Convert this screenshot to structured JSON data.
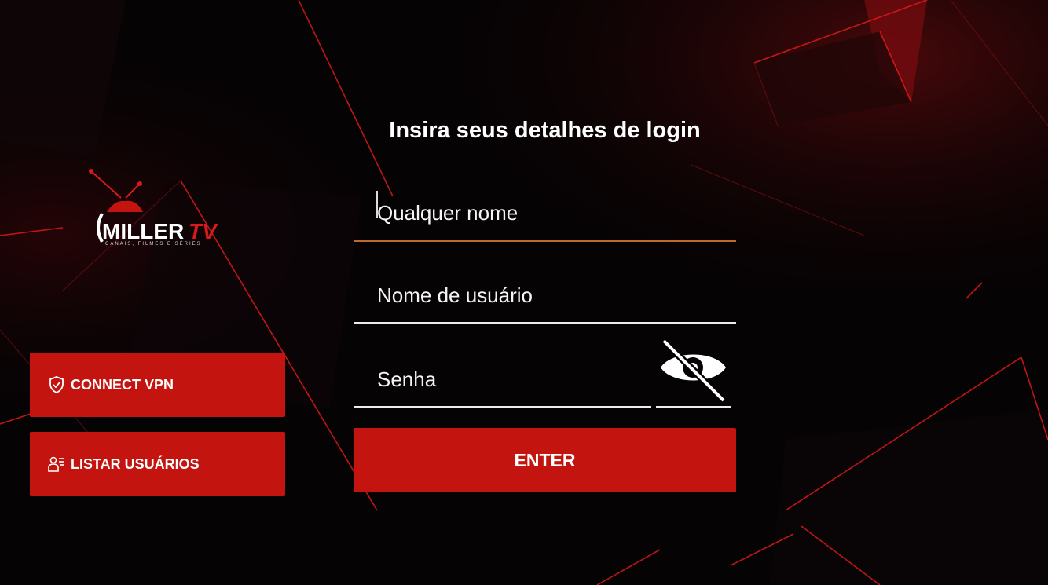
{
  "login": {
    "title": "Insira seus detalhes de login",
    "name_placeholder": "Qualquer nome",
    "username_placeholder": "Nome de usuário",
    "password_placeholder": "Senha",
    "enter_label": "ENTER"
  },
  "sidebar": {
    "logo_text": "MILLERTV",
    "logo_tagline": "CANAIS, FILMES E SÉRIES",
    "buttons": [
      {
        "label": "CONNECT VPN",
        "icon": "shield-check-icon"
      },
      {
        "label": "LISTAR USUÁRIOS",
        "icon": "user-list-icon"
      }
    ]
  },
  "colors": {
    "accent": "#c4140f",
    "background": "#050203",
    "active_underline": "#c06a2a"
  },
  "icons": {
    "password_toggle": "eye-slash-icon"
  }
}
